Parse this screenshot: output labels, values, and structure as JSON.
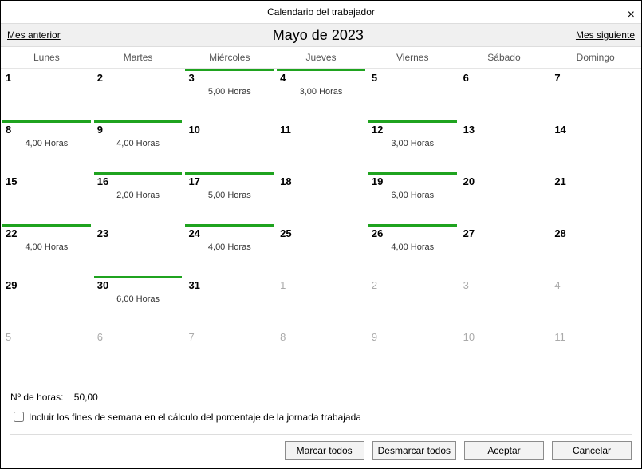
{
  "window_title": "Calendario del trabajador",
  "nav": {
    "prev": "Mes anterior",
    "title": "Mayo de 2023",
    "next": "Mes siguiente"
  },
  "day_names": [
    "Lunes",
    "Martes",
    "Miércoles",
    "Jueves",
    "Viernes",
    "Sábado",
    "Domingo"
  ],
  "weeks": [
    [
      {
        "n": "1",
        "fade": false,
        "mark": false,
        "hours": ""
      },
      {
        "n": "2",
        "fade": false,
        "mark": false,
        "hours": ""
      },
      {
        "n": "3",
        "fade": false,
        "mark": true,
        "hours": "5,00 Horas"
      },
      {
        "n": "4",
        "fade": false,
        "mark": true,
        "hours": "3,00 Horas"
      },
      {
        "n": "5",
        "fade": false,
        "mark": false,
        "hours": ""
      },
      {
        "n": "6",
        "fade": false,
        "mark": false,
        "hours": ""
      },
      {
        "n": "7",
        "fade": false,
        "mark": false,
        "hours": ""
      }
    ],
    [
      {
        "n": "8",
        "fade": false,
        "mark": true,
        "hours": "4,00 Horas"
      },
      {
        "n": "9",
        "fade": false,
        "mark": true,
        "hours": "4,00 Horas"
      },
      {
        "n": "10",
        "fade": false,
        "mark": false,
        "hours": ""
      },
      {
        "n": "11",
        "fade": false,
        "mark": false,
        "hours": ""
      },
      {
        "n": "12",
        "fade": false,
        "mark": true,
        "hours": "3,00 Horas"
      },
      {
        "n": "13",
        "fade": false,
        "mark": false,
        "hours": ""
      },
      {
        "n": "14",
        "fade": false,
        "mark": false,
        "hours": ""
      }
    ],
    [
      {
        "n": "15",
        "fade": false,
        "mark": false,
        "hours": ""
      },
      {
        "n": "16",
        "fade": false,
        "mark": true,
        "hours": "2,00 Horas"
      },
      {
        "n": "17",
        "fade": false,
        "mark": true,
        "hours": "5,00 Horas"
      },
      {
        "n": "18",
        "fade": false,
        "mark": false,
        "hours": ""
      },
      {
        "n": "19",
        "fade": false,
        "mark": true,
        "hours": "6,00 Horas"
      },
      {
        "n": "20",
        "fade": false,
        "mark": false,
        "hours": ""
      },
      {
        "n": "21",
        "fade": false,
        "mark": false,
        "hours": ""
      }
    ],
    [
      {
        "n": "22",
        "fade": false,
        "mark": true,
        "hours": "4,00 Horas"
      },
      {
        "n": "23",
        "fade": false,
        "mark": false,
        "hours": ""
      },
      {
        "n": "24",
        "fade": false,
        "mark": true,
        "hours": "4,00 Horas"
      },
      {
        "n": "25",
        "fade": false,
        "mark": false,
        "hours": ""
      },
      {
        "n": "26",
        "fade": false,
        "mark": true,
        "hours": "4,00 Horas"
      },
      {
        "n": "27",
        "fade": false,
        "mark": false,
        "hours": ""
      },
      {
        "n": "28",
        "fade": false,
        "mark": false,
        "hours": ""
      }
    ],
    [
      {
        "n": "29",
        "fade": false,
        "mark": false,
        "hours": ""
      },
      {
        "n": "30",
        "fade": false,
        "mark": true,
        "hours": "6,00 Horas"
      },
      {
        "n": "31",
        "fade": false,
        "mark": false,
        "hours": ""
      },
      {
        "n": "1",
        "fade": true,
        "mark": false,
        "hours": ""
      },
      {
        "n": "2",
        "fade": true,
        "mark": false,
        "hours": ""
      },
      {
        "n": "3",
        "fade": true,
        "mark": false,
        "hours": ""
      },
      {
        "n": "4",
        "fade": true,
        "mark": false,
        "hours": ""
      }
    ],
    [
      {
        "n": "5",
        "fade": true,
        "mark": false,
        "hours": ""
      },
      {
        "n": "6",
        "fade": true,
        "mark": false,
        "hours": ""
      },
      {
        "n": "7",
        "fade": true,
        "mark": false,
        "hours": ""
      },
      {
        "n": "8",
        "fade": true,
        "mark": false,
        "hours": ""
      },
      {
        "n": "9",
        "fade": true,
        "mark": false,
        "hours": ""
      },
      {
        "n": "10",
        "fade": true,
        "mark": false,
        "hours": ""
      },
      {
        "n": "11",
        "fade": true,
        "mark": false,
        "hours": ""
      }
    ]
  ],
  "total": {
    "label": "Nº de horas:",
    "value": "50,00"
  },
  "checkbox_label": "Incluir los fines de semana en el cálculo del porcentaje de la jornada trabajada",
  "buttons": {
    "mark_all": "Marcar todos",
    "unmark_all": "Desmarcar todos",
    "accept": "Aceptar",
    "cancel": "Cancelar"
  }
}
